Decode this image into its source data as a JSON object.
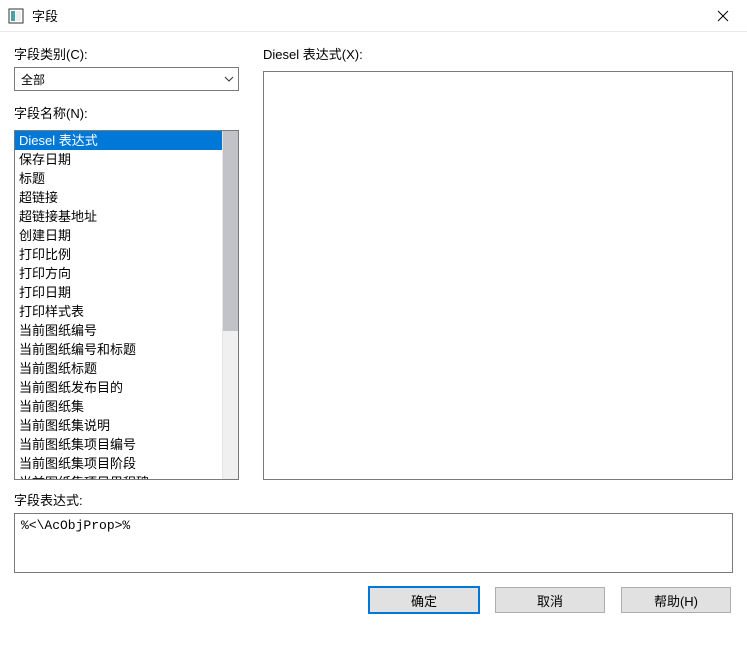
{
  "window": {
    "title": "字段"
  },
  "labels": {
    "category": "字段类别(C):",
    "name": "字段名称(N):",
    "diesel_expr": "Diesel 表达式(X):",
    "field_expr": "字段表达式:"
  },
  "category": {
    "selected": "全部"
  },
  "field_names": {
    "items": [
      "Diesel 表达式",
      "保存日期",
      "标题",
      "超链接",
      "超链接基地址",
      "创建日期",
      "打印比例",
      "打印方向",
      "打印日期",
      "打印样式表",
      "当前图纸编号",
      "当前图纸编号和标题",
      "当前图纸标题",
      "当前图纸发布目的",
      "当前图纸集",
      "当前图纸集说明",
      "当前图纸集项目编号",
      "当前图纸集项目阶段",
      "当前图纸集项目里程碑"
    ],
    "selected_index": 0
  },
  "diesel_expression": "",
  "field_expression": "%<\\AcObjProp>%",
  "buttons": {
    "ok": "确定",
    "cancel": "取消",
    "help": "帮助(H)"
  }
}
